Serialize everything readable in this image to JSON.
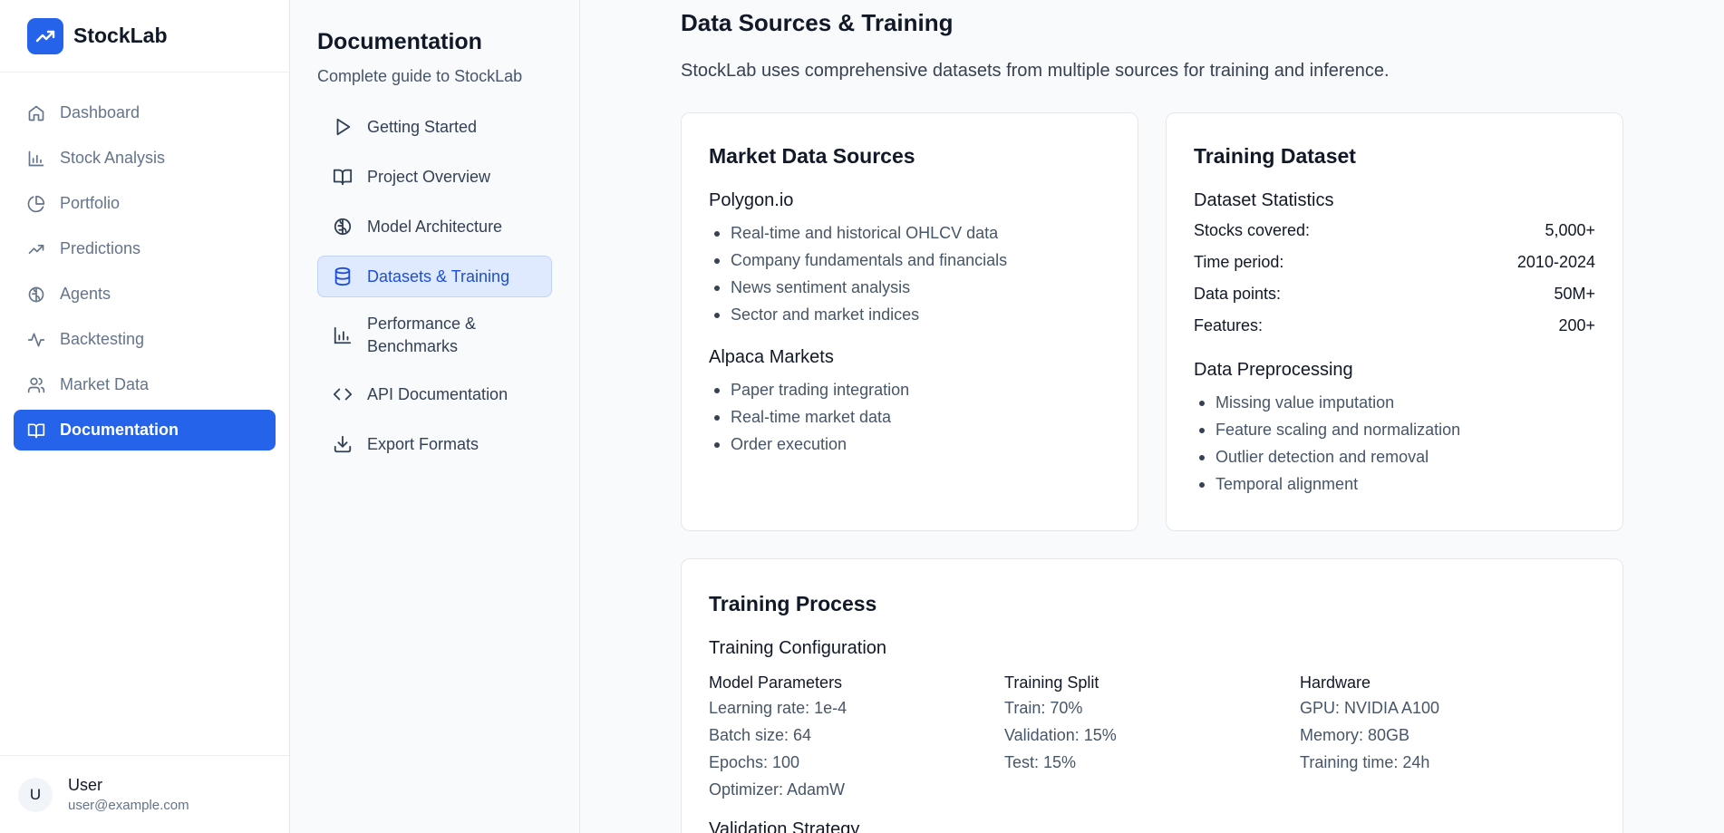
{
  "brand": {
    "name": "StockLab"
  },
  "sidebar": {
    "items": [
      {
        "label": "Dashboard",
        "icon": "home-icon"
      },
      {
        "label": "Stock Analysis",
        "icon": "bar-chart-icon"
      },
      {
        "label": "Portfolio",
        "icon": "pie-chart-icon"
      },
      {
        "label": "Predictions",
        "icon": "trending-up-icon"
      },
      {
        "label": "Agents",
        "icon": "brain-icon"
      },
      {
        "label": "Backtesting",
        "icon": "activity-icon"
      },
      {
        "label": "Market Data",
        "icon": "users-icon"
      },
      {
        "label": "Documentation",
        "icon": "book-icon",
        "active": true
      }
    ]
  },
  "user": {
    "initial": "U",
    "name": "User",
    "email": "user@example.com"
  },
  "docnav": {
    "title": "Documentation",
    "subtitle": "Complete guide to StockLab",
    "items": [
      {
        "label": "Getting Started",
        "icon": "play-icon"
      },
      {
        "label": "Project Overview",
        "icon": "book-open-icon"
      },
      {
        "label": "Model Architecture",
        "icon": "brain-icon"
      },
      {
        "label": "Datasets & Training",
        "icon": "database-icon",
        "active": true
      },
      {
        "label": "Performance & Benchmarks",
        "icon": "bar-chart-icon"
      },
      {
        "label": "API Documentation",
        "icon": "code-icon"
      },
      {
        "label": "Export Formats",
        "icon": "download-icon"
      }
    ]
  },
  "main": {
    "title": "Data Sources & Training",
    "lead": "StockLab uses comprehensive datasets from multiple sources for training and inference.",
    "market_sources": {
      "title": "Market Data Sources",
      "groups": [
        {
          "name": "Polygon.io",
          "items": [
            "Real-time and historical OHLCV data",
            "Company fundamentals and financials",
            "News sentiment analysis",
            "Sector and market indices"
          ]
        },
        {
          "name": "Alpaca Markets",
          "items": [
            "Paper trading integration",
            "Real-time market data",
            "Order execution"
          ]
        }
      ]
    },
    "training_dataset": {
      "title": "Training Dataset",
      "stats_title": "Dataset Statistics",
      "stats": [
        {
          "label": "Stocks covered:",
          "value": "5,000+"
        },
        {
          "label": "Time period:",
          "value": "2010-2024"
        },
        {
          "label": "Data points:",
          "value": "50M+"
        },
        {
          "label": "Features:",
          "value": "200+"
        }
      ],
      "preprocessing_title": "Data Preprocessing",
      "preprocessing": [
        "Missing value imputation",
        "Feature scaling and normalization",
        "Outlier detection and removal",
        "Temporal alignment"
      ]
    },
    "training_process": {
      "title": "Training Process",
      "config_title": "Training Configuration",
      "columns": [
        {
          "heading": "Model Parameters",
          "lines": [
            "Learning rate: 1e-4",
            "Batch size: 64",
            "Epochs: 100",
            "Optimizer: AdamW"
          ]
        },
        {
          "heading": "Training Split",
          "lines": [
            "Train: 70%",
            "Validation: 15%",
            "Test: 15%"
          ]
        },
        {
          "heading": "Hardware",
          "lines": [
            "GPU: NVIDIA A100",
            "Memory: 80GB",
            "Training time: 24h"
          ]
        }
      ],
      "next_title": "Validation Strategy"
    }
  }
}
